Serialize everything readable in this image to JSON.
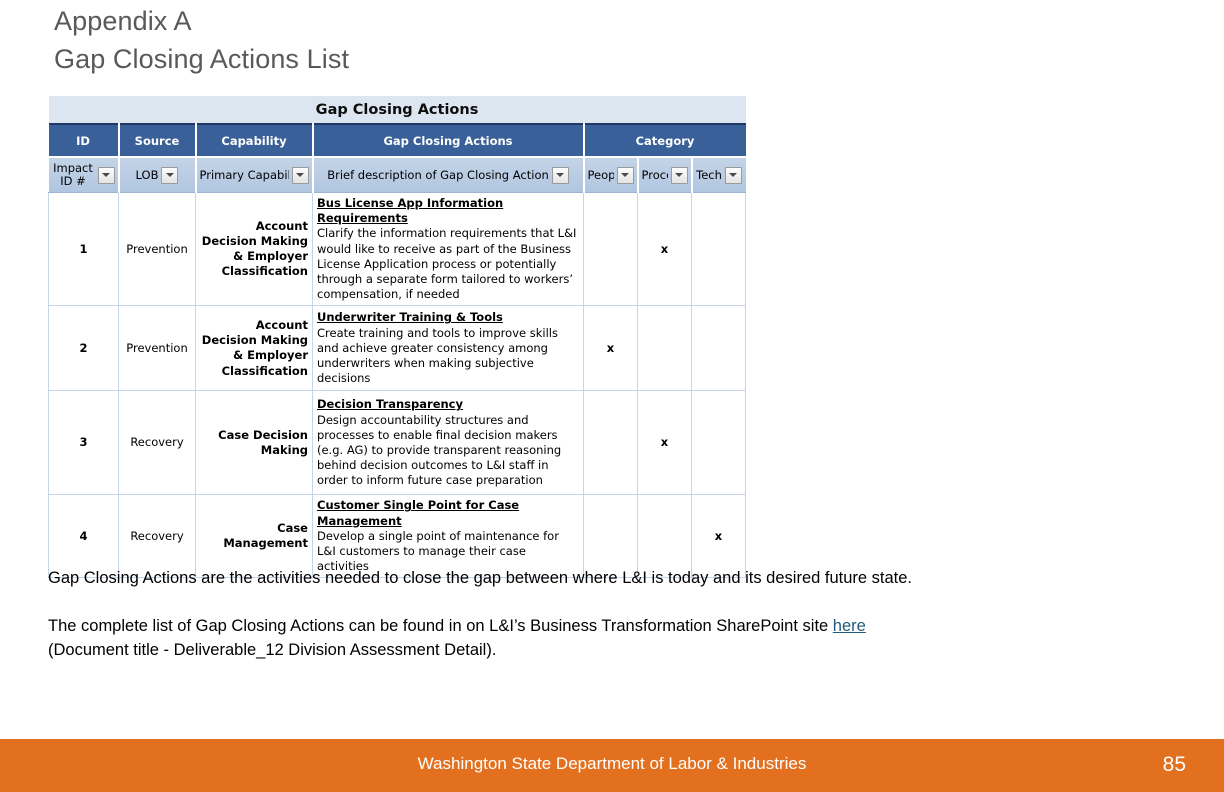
{
  "slide": {
    "title_line1": "Appendix A",
    "title_line2": "Gap Closing Actions List"
  },
  "table": {
    "caption": "Gap Closing Actions",
    "group_headers": [
      {
        "label": "ID"
      },
      {
        "label": "Source"
      },
      {
        "label": "Capability"
      },
      {
        "label": "Gap Closing Actions"
      },
      {
        "label": "Category"
      }
    ],
    "filter_headers": [
      {
        "label": "Impact ID #",
        "filter_icon": "chevron-down-icon"
      },
      {
        "label": "LOB",
        "filter_icon": "chevron-down-icon"
      },
      {
        "label": "Primary Capabil",
        "filter_icon": "chevron-down-icon"
      },
      {
        "label": "Brief description of Gap Closing Action",
        "filter_icon": "chevron-down-icon"
      },
      {
        "label": "Peop'",
        "filter_icon": "chevron-down-icon"
      },
      {
        "label": "Proce",
        "filter_icon": "chevron-down-icon"
      },
      {
        "label": "Tech",
        "filter_icon": "chevron-down-icon"
      }
    ],
    "rows": [
      {
        "id": "1",
        "source": "Prevention",
        "capability": "Account Decision Making & Employer Classification",
        "action_title": "Bus License App Information Requirements",
        "action_body": "Clarify the information requirements that L&I would like to receive as part of the Business License Application process or potentially through a separate form tailored to workers’ compensation, if needed",
        "people": "",
        "process": "x",
        "technology": ""
      },
      {
        "id": "2",
        "source": "Prevention",
        "capability": "Account Decision Making & Employer Classification",
        "action_title": "Underwriter Training & Tools",
        "action_body": "Create training and tools to improve skills and achieve greater consistency among underwriters when making subjective decisions",
        "people": "x",
        "process": "",
        "technology": ""
      },
      {
        "id": "3",
        "source": "Recovery",
        "capability": "Case Decision Making",
        "action_title": "Decision Transparency",
        "action_body": "Design accountability structures and processes to enable final decision makers (e.g. AG) to provide transparent reasoning behind decision outcomes to L&I staff in order to inform future case preparation",
        "people": "",
        "process": "x",
        "technology": ""
      },
      {
        "id": "4",
        "source": "Recovery",
        "capability": "Case Management",
        "action_title": "Customer Single Point for Case Management",
        "action_body": "Develop a single point of maintenance for L&I customers to manage their case activities",
        "people": "",
        "process": "",
        "technology": "x"
      }
    ]
  },
  "body": {
    "paragraph1": "Gap Closing Actions are the activities needed to close the gap between where L&I is today and its desired future state.",
    "paragraph2_before": "The complete list of Gap Closing Actions can be found in on L&I’s Business Transformation SharePoint site ",
    "paragraph2_link": "here",
    "paragraph2_after": "(Document title - Deliverable_12 Division Assessment Detail)."
  },
  "footer": {
    "organization": "Washington State Department of Labor & Industries",
    "page_number": "85",
    "bar_color": "#e2701f"
  }
}
